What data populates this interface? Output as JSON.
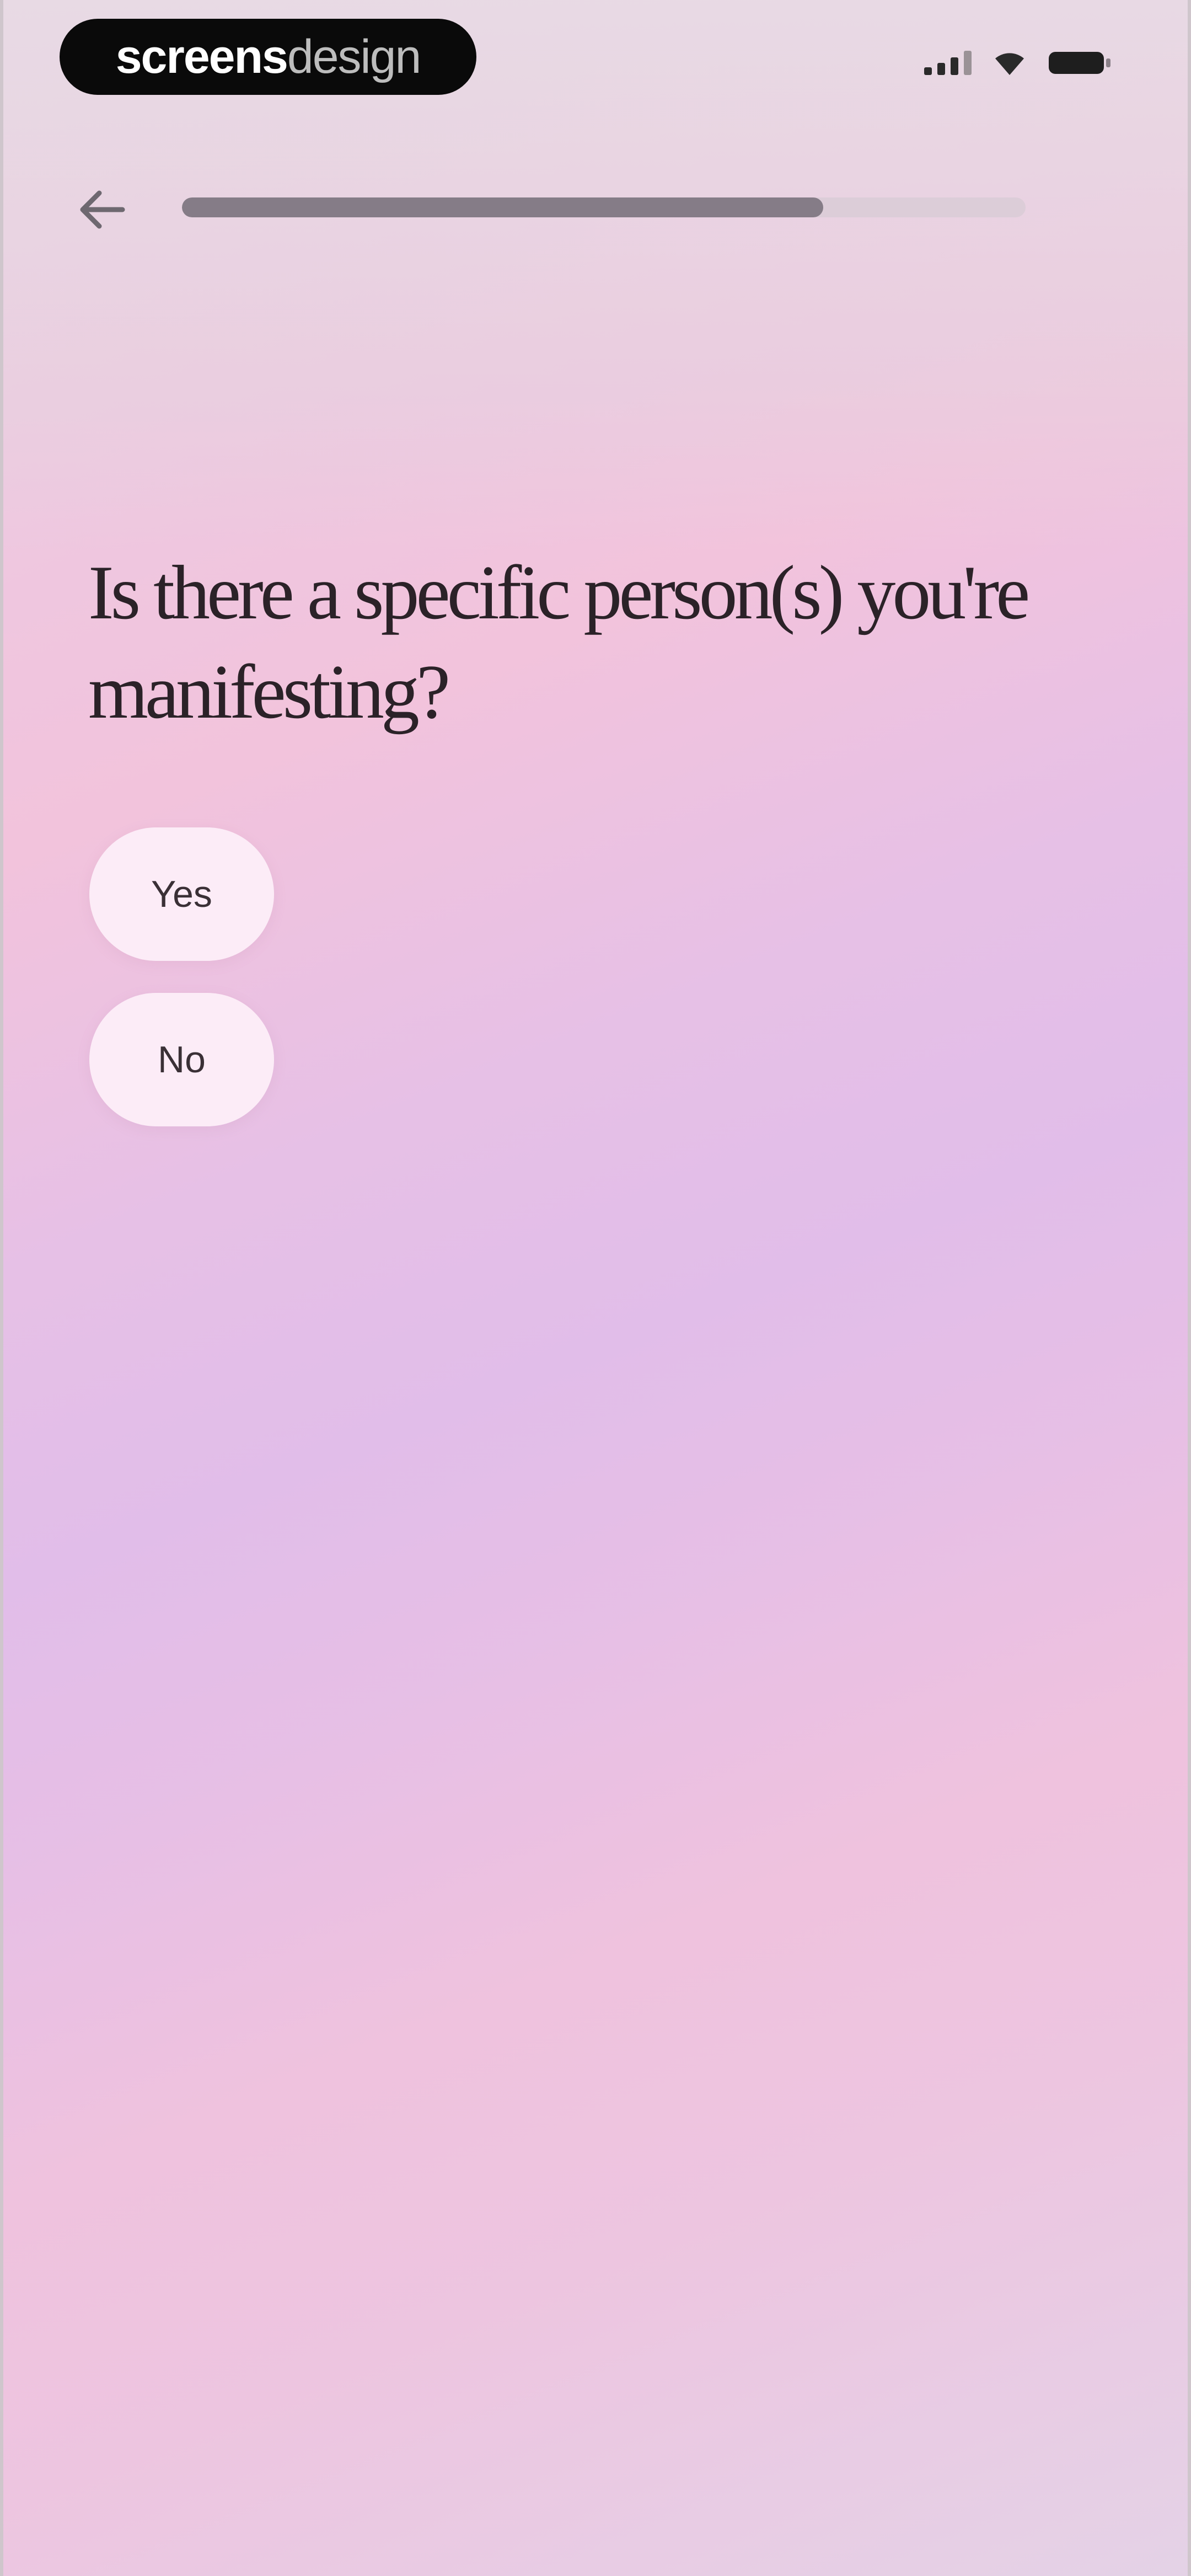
{
  "brand": {
    "strong": "screens",
    "light": "design"
  },
  "status_bar": {
    "icons": [
      "signal-icon",
      "wifi-icon",
      "battery-icon"
    ]
  },
  "nav": {
    "back_icon": "arrow-left-icon",
    "progress": 0.76
  },
  "question": {
    "title": "Is there a specific person(s) you're manifesting?"
  },
  "answers": [
    {
      "label": "Yes"
    },
    {
      "label": "No"
    }
  ],
  "colors": {
    "progress_fill": "#857c87",
    "title_text": "#2b2228",
    "answer_bg": "#fdf0f8"
  }
}
